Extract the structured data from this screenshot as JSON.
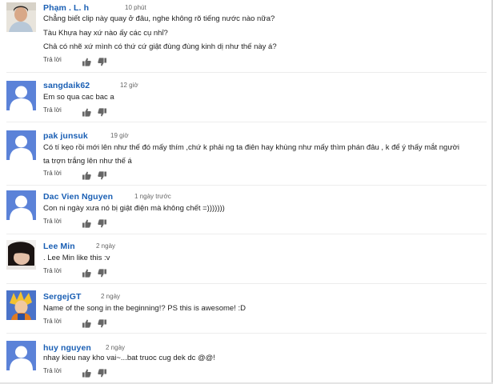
{
  "reply_label": "Trả lời",
  "comments": [
    {
      "author": "Phạm . L. h",
      "time": "10 phút",
      "avatar": "photo-boy",
      "lines": [
        "Chẳng biết clip này quay ở đâu, nghe không rõ tiếng nước nào nữa?",
        "Tàu Khựa hay xứ nào ấy các cụ nhỉ?",
        "Chả có nhẽ xứ mình có thứ cứ giật đùng đùng kinh dị như thế này á?"
      ]
    },
    {
      "author": "sangdaik62",
      "time": "12 giờ",
      "avatar": "default",
      "lines": [
        "Em so qua cac bac a"
      ]
    },
    {
      "author": "pak junsuk",
      "time": "19 giờ",
      "avatar": "default",
      "lines": [
        "Có tí kẹo rồi mới lên như thế đó mấy thím ,chứ k phải ng ta điên hay khùng như mấy thìm phán đâu , k để ý thấy mắt người",
        "ta trợn trắng lên như thế á"
      ]
    },
    {
      "author": "Dac Vien Nguyen",
      "time": "1 ngày trước",
      "avatar": "default",
      "lines": [
        "Con ni ngày xưa nó bị giật điện mà không chết =)))))))"
      ]
    },
    {
      "author": "Lee Min",
      "time": "2 ngày",
      "avatar": "photo-girl",
      "lines": [
        ". Lee Min like this :v"
      ]
    },
    {
      "author": "SergejGT",
      "time": "2 ngày",
      "avatar": "photo-anime",
      "lines": [
        "Name of the song in the beginning!? PS this is awesome! :D"
      ]
    },
    {
      "author": "huy nguyen",
      "time": "2 ngày",
      "avatar": "default",
      "lines": [
        "nhay kieu nay kho vai~...bat truoc cug dek dc @@!"
      ]
    }
  ],
  "colors": {
    "name": "#1a5fb4",
    "avatar_default": "#5b82d8"
  }
}
